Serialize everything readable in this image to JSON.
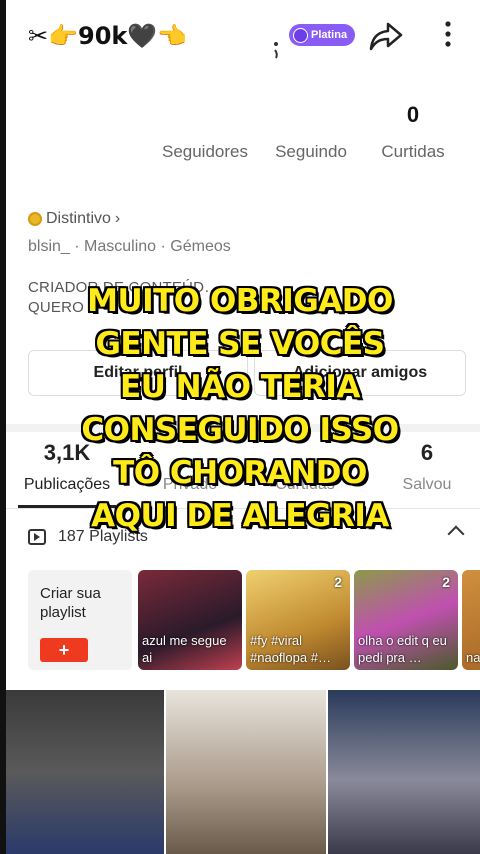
{
  "header": {
    "username": "✂👉90k🖤👈",
    "badge_label": "Platina"
  },
  "stats": [
    {
      "value": "",
      "label": "Seguidores"
    },
    {
      "value": "",
      "label": "Seguindo"
    },
    {
      "value": "0",
      "label": "Curtidas"
    }
  ],
  "bio": {
    "badge": "Distintivo",
    "meta": "blsin_  ·  Masculino  ·  Gémeos",
    "text_line1": "CRIADOR DE CONTEÚD…",
    "text_line2": "QUERO"
  },
  "buttons": {
    "edit": "Editar perfil",
    "add_friends": "Adicionar amigos"
  },
  "tabs": [
    {
      "value": "3,1K",
      "label": "Publicações"
    },
    {
      "value": "",
      "label": "Privado"
    },
    {
      "value": "",
      "label": "Curtidas"
    },
    {
      "value": "6",
      "label": "Salvou"
    }
  ],
  "playlists": {
    "title": "187 Playlists",
    "create_label": "Criar sua playlist",
    "create_button": "+",
    "cards": [
      {
        "count": "",
        "caption": "azul me segue ai",
        "color": "#5b2a3a"
      },
      {
        "count": "2",
        "caption": "#fy #viral #naoflopa #…",
        "color": "#d9a23a"
      },
      {
        "count": "2",
        "caption": "olha o edit q eu pedi pra …",
        "color": "#6a7a3a"
      },
      {
        "count": "",
        "caption": "na",
        "color": "#b07030"
      }
    ]
  },
  "overlay": {
    "lines": [
      "MUITO OBRIGADO",
      "GENTE SE VOCÊS",
      "EU NÃO TERIA",
      "CONSEGUIDO ISSO",
      "TÔ CHORANDO",
      "AQUI DE ALEGRIA"
    ]
  },
  "videos": [
    {
      "color": "#4a4a4a"
    },
    {
      "color": "#b8aea0"
    },
    {
      "color": "#3a4a6a"
    }
  ]
}
